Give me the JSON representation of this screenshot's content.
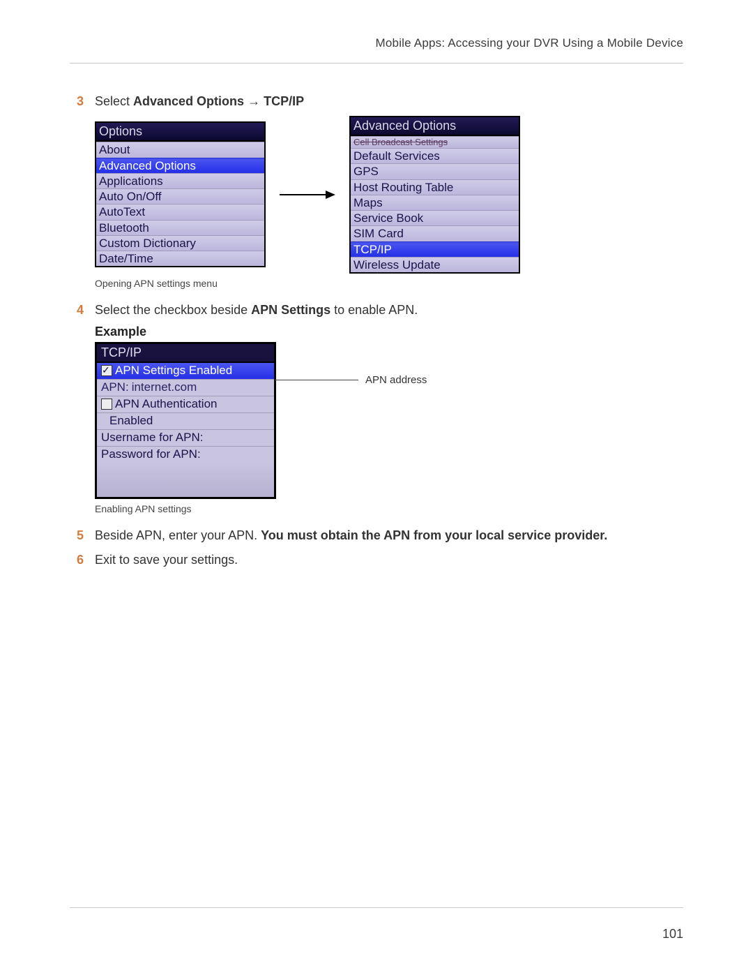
{
  "header": {
    "breadcrumb": "Mobile Apps: Accessing your DVR Using a Mobile Device"
  },
  "page_number": "101",
  "steps": {
    "s3": {
      "num": "3",
      "lead": "Select ",
      "bold1": "Advanced Options",
      "arrow": " → ",
      "bold2": "TCP/IP"
    },
    "s4": {
      "num": "4",
      "lead": "Select the checkbox beside ",
      "bold1": "APN Settings",
      "trail": " to enable APN."
    },
    "s5": {
      "num": "5",
      "lead": "Beside APN, enter your APN. ",
      "bold1": "You must obtain the APN from your local service provider."
    },
    "s6": {
      "num": "6",
      "text": "Exit to save your settings."
    }
  },
  "figure1": {
    "caption": "Opening APN settings menu",
    "left_title": "Options",
    "left_items": {
      "i0": "About",
      "i1": "Advanced Options",
      "i2": "Applications",
      "i3": "Auto On/Off",
      "i4": "AutoText",
      "i5": "Bluetooth",
      "i6": "Custom Dictionary",
      "i7": "Date/Time"
    },
    "right_title": "Advanced Options",
    "right_items": {
      "r0": "Cell Broadcast Settings",
      "r1": "Default Services",
      "r2": "GPS",
      "r3": "Host Routing Table",
      "r4": "Maps",
      "r5": "Service Book",
      "r6": "SIM Card",
      "r7": "TCP/IP",
      "r8": "Wireless Update"
    }
  },
  "example_heading": "Example",
  "figure2": {
    "caption": "Enabling APN settings",
    "title": "TCP/IP",
    "rows": {
      "r0": "APN Settings Enabled",
      "r1a": "APN: ",
      "r1b": "internet.com",
      "r2": "APN Authentication",
      "r3": "Enabled",
      "r4": "Username for APN:",
      "r5": "Password for APN:"
    },
    "annotation": "APN address"
  }
}
